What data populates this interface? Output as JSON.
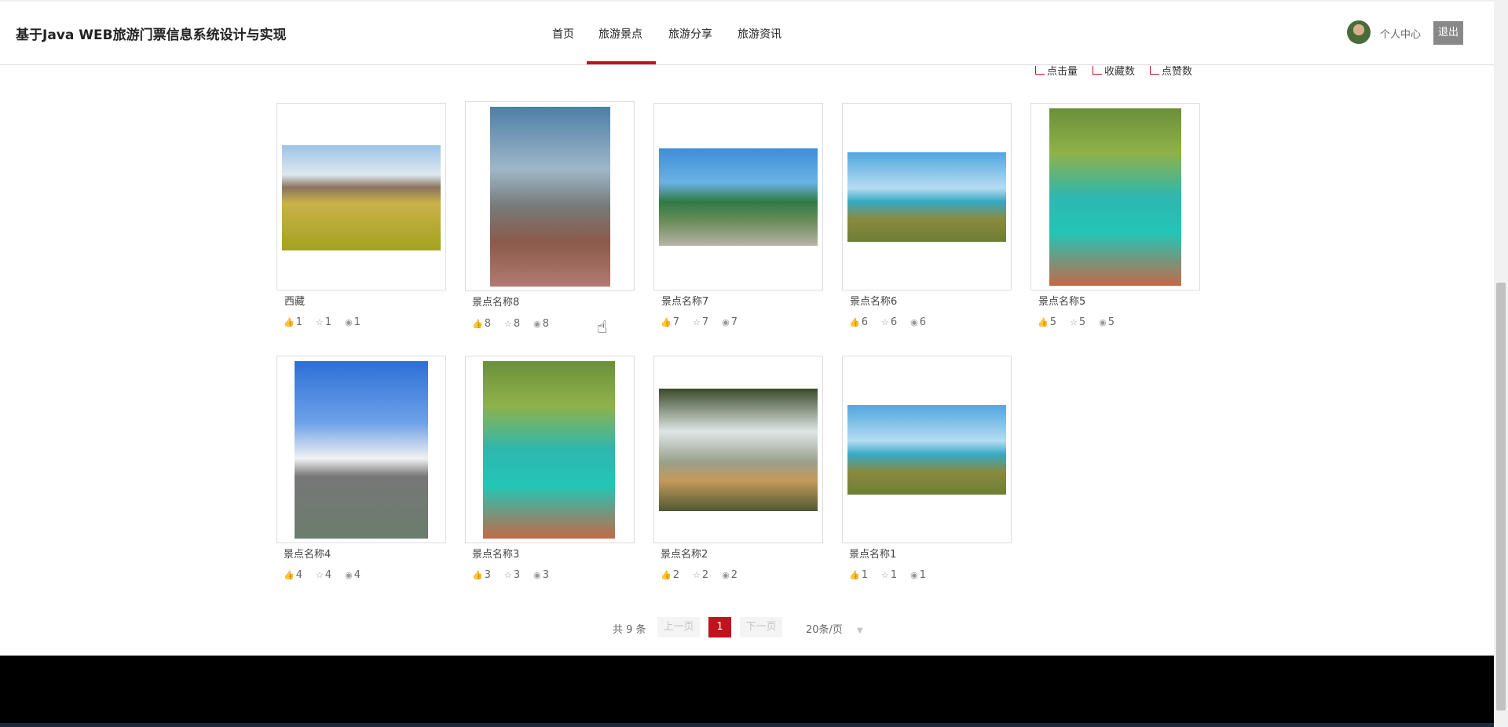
{
  "header": {
    "site_title": "基于Java WEB旅游门票信息系统设计与实现",
    "nav": [
      "首页",
      "旅游景点",
      "旅游分享",
      "旅游资讯"
    ],
    "active_nav": "旅游景点",
    "user_center": "个人中心",
    "logout": "退出"
  },
  "sort": {
    "options": [
      "点击量",
      "收藏数",
      "点赞数"
    ]
  },
  "spots": [
    {
      "name": "西藏",
      "likes": "1",
      "favorites": "1",
      "views": "1"
    },
    {
      "name": "景点名称8",
      "likes": "8",
      "favorites": "8",
      "views": "8"
    },
    {
      "name": "景点名称7",
      "likes": "7",
      "favorites": "7",
      "views": "7"
    },
    {
      "name": "景点名称6",
      "likes": "6",
      "favorites": "6",
      "views": "6"
    },
    {
      "name": "景点名称5",
      "likes": "5",
      "favorites": "5",
      "views": "5"
    },
    {
      "name": "景点名称4",
      "likes": "4",
      "favorites": "4",
      "views": "4"
    },
    {
      "name": "景点名称3",
      "likes": "3",
      "favorites": "3",
      "views": "3"
    },
    {
      "name": "景点名称2",
      "likes": "2",
      "favorites": "2",
      "views": "2"
    },
    {
      "name": "景点名称1",
      "likes": "1",
      "favorites": "1",
      "views": "1"
    }
  ],
  "pagination": {
    "total": "共 9 条",
    "prev": "上一页",
    "current_page": "1",
    "next": "下一页",
    "page_size": "20条/页"
  }
}
